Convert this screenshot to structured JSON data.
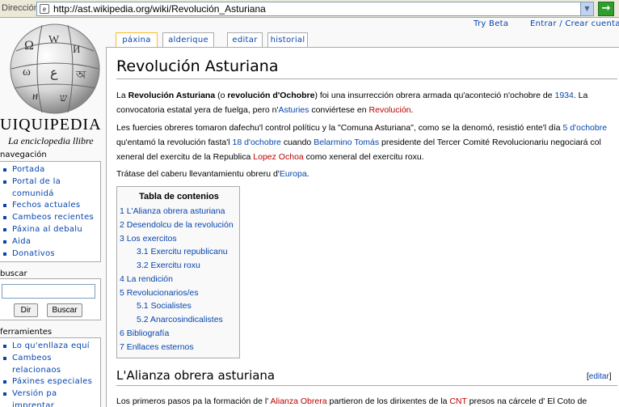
{
  "browser": {
    "address_label": "Dirección",
    "url": "http://ast.wikipedia.org/wiki/Revolución_Asturiana",
    "go_symbol": "→"
  },
  "logo": {
    "name": "UIQUIPEDIA",
    "tagline": "La enciclopedia llibre"
  },
  "personal": {
    "try_beta": "Try Beta",
    "login": "Entrar / Crear cuenta"
  },
  "tabs": [
    {
      "label": "páxina"
    },
    {
      "label": "alderique"
    },
    {
      "label": "editar"
    },
    {
      "label": "historial"
    }
  ],
  "navigation": {
    "heading": "navegación",
    "items": [
      {
        "label": "Portada"
      },
      {
        "label": "Portal de la comunidá"
      },
      {
        "label": "Fechos actuales"
      },
      {
        "label": "Cambeos recientes"
      },
      {
        "label": "Páxina al debalu"
      },
      {
        "label": "Aida"
      },
      {
        "label": "Donativos"
      }
    ]
  },
  "search": {
    "heading": "buscar",
    "value": "",
    "go_label": "Dir",
    "search_label": "Buscar"
  },
  "tools": {
    "heading": "ferramientes",
    "items": [
      {
        "label": "Lo qu'enllaza equí"
      },
      {
        "label": "Cambeos relacionaos"
      },
      {
        "label": "Páxines especiales"
      },
      {
        "label": "Versión pa imprentar"
      }
    ]
  },
  "article": {
    "title": "Revolución Asturiana",
    "p1": {
      "t1": "La ",
      "b1": "Revolución Asturiana",
      "t2": " (o ",
      "b2": "revolución d'Ochobre",
      "t3": ") foi una insurrección obrera armada qu'aconteció n'ochobre de ",
      "l1": "1934",
      "t4": ". La convocatoria estatal yera de fuelga, pero n'",
      "l2": "Asturies",
      "t5": " conviértese en ",
      "l3": "Revolución",
      "t6": "."
    },
    "p2": {
      "t1": "Les fuercies obreres tomaron dafechu'l control políticu y la \"Comuna Asturiana\", como se la denomó, resistió ente'l día ",
      "l1": "5 d'ochobre",
      "t2": " qu'entamó la revolución fasta'l ",
      "l2": "18 d'ochobre",
      "t3": " cuando ",
      "l3": "Belarmino Tomás",
      "t4": " presidente del Tercer Comité Revolucionariu negociará col xeneral del exercitu de la Republica ",
      "l4": "Lopez Ochoa",
      "t5": " como xeneral del exercitu roxu."
    },
    "p3": {
      "t1": "Trátase del caberu llevantamientu obreru d'",
      "l1": "Europa",
      "t2": "."
    },
    "toc": {
      "title": "Tabla de contenios",
      "items": [
        {
          "label": "1 L'Alianza obrera asturiana"
        },
        {
          "label": "2 Desendolcu de la revolución"
        },
        {
          "label": "3 Los exercitos"
        },
        {
          "label": "3.1 Exercitu republicanu"
        },
        {
          "label": "3.2 Exercitu roxu"
        },
        {
          "label": "4 La rendición"
        },
        {
          "label": "5 Revolucionarios/es"
        },
        {
          "label": "5.1 Socialistes"
        },
        {
          "label": "5.2 Anarcosindicalistes"
        },
        {
          "label": "6 Bibliografía"
        },
        {
          "label": "7 Enllaces esternos"
        }
      ]
    },
    "section1": {
      "heading": "L'Alianza obrera asturiana",
      "edit_open": "[",
      "edit_label": "editar",
      "edit_close": "]"
    },
    "p4": {
      "t1": "Los primeros pasos pa la formación de l' ",
      "l1": "Alianza Obrera",
      "t2": " partieron de los dirixentes de la ",
      "l2": "CNT",
      "t3": " presos na cárcele d' El Coto de"
    }
  }
}
